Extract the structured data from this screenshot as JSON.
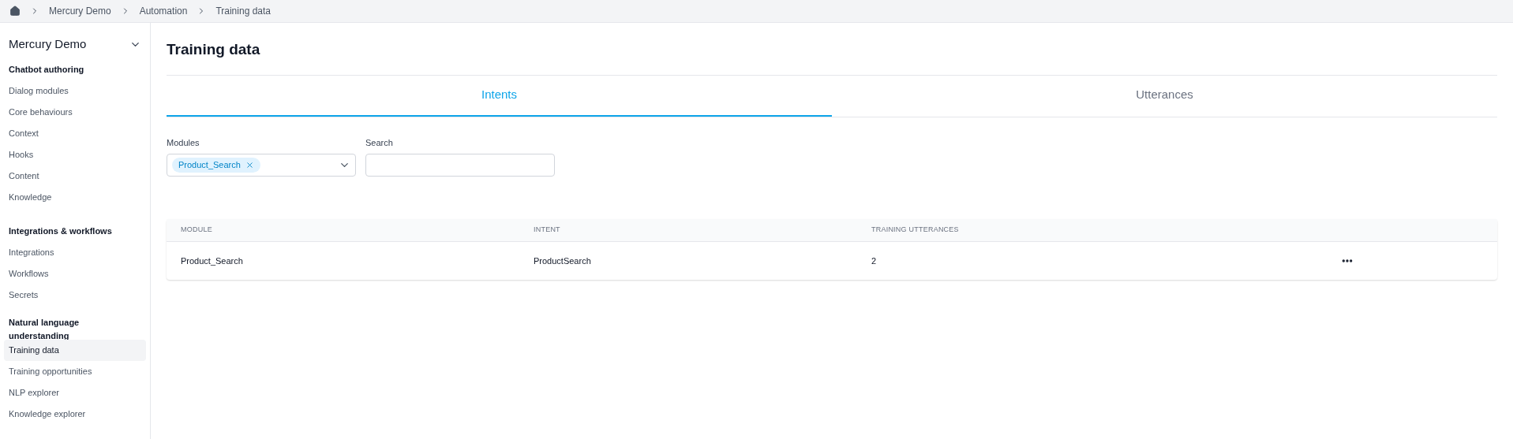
{
  "breadcrumb": [
    "Mercury Demo",
    "Automation",
    "Training data"
  ],
  "sidebar": {
    "title": "Mercury Demo",
    "sections": [
      {
        "heading": "Chatbot authoring",
        "items": [
          {
            "label": "Dialog modules",
            "selected": false
          },
          {
            "label": "Core behaviours",
            "selected": false
          },
          {
            "label": "Context",
            "selected": false
          },
          {
            "label": "Hooks",
            "selected": false
          },
          {
            "label": "Content",
            "selected": false
          },
          {
            "label": "Knowledge",
            "selected": false
          }
        ]
      },
      {
        "heading": "Integrations & workflows",
        "items": [
          {
            "label": "Integrations",
            "selected": false
          },
          {
            "label": "Workflows",
            "selected": false
          },
          {
            "label": "Secrets",
            "selected": false
          }
        ]
      },
      {
        "heading": "Natural language understanding",
        "items": [
          {
            "label": "Training data",
            "selected": true
          },
          {
            "label": "Training opportunities",
            "selected": false
          },
          {
            "label": "NLP explorer",
            "selected": false
          },
          {
            "label": "Knowledge explorer",
            "selected": false
          }
        ]
      }
    ]
  },
  "page_title": "Training data",
  "tabs": [
    {
      "label": "Intents",
      "selected": true
    },
    {
      "label": "Utterances",
      "selected": false
    }
  ],
  "filters": {
    "modules": {
      "label": "Modules",
      "chips": [
        "Product_Search"
      ]
    },
    "search": {
      "label": "Search"
    }
  },
  "table": {
    "columns": [
      "MODULE",
      "INTENT",
      "TRAINING UTTERANCES"
    ],
    "rows": [
      {
        "cells": [
          "Product_Search",
          "ProductSearch",
          "2"
        ]
      }
    ]
  }
}
